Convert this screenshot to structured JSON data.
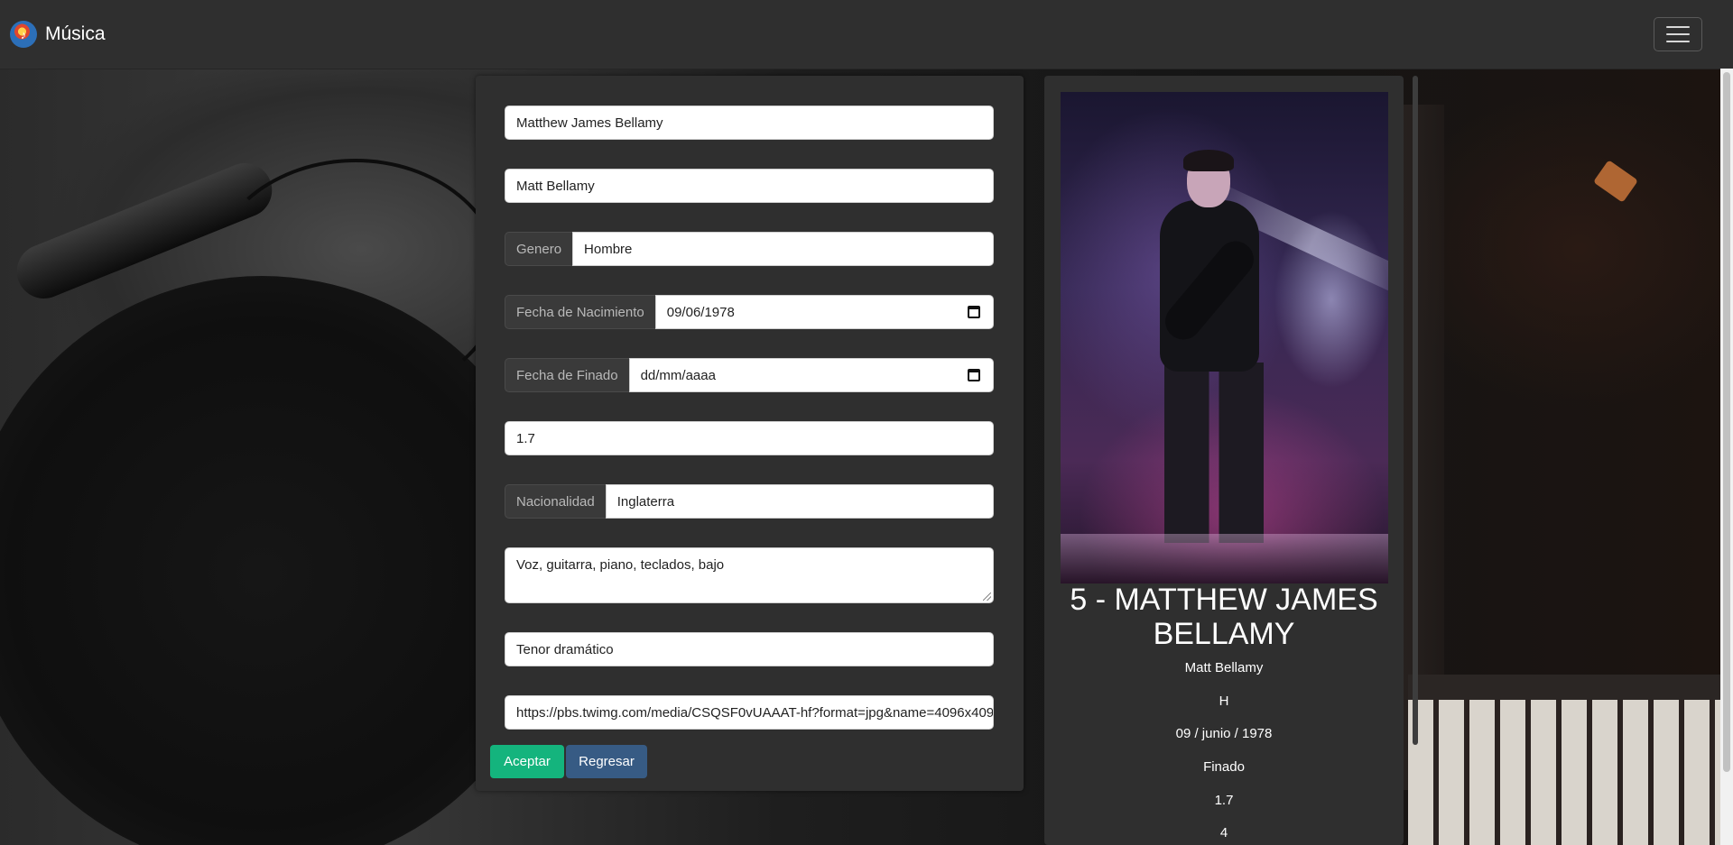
{
  "navbar": {
    "brand_logo_icon": "music-note-icon",
    "brand": "Música",
    "menu_icon": "hamburger-menu-icon"
  },
  "form": {
    "full_name": "Matthew James Bellamy",
    "stage_name": "Matt Bellamy",
    "genero_label": "Genero",
    "genero_value": "Hombre",
    "birth_label": "Fecha de Nacimiento",
    "birth_value": "09/06/1978",
    "death_label": "Fecha de Finado",
    "death_value": "dd/mm/aaaa",
    "height": "1.7",
    "nationality_label": "Nacionalidad",
    "nationality_value": "Inglaterra",
    "instruments": "Voz, guitarra, piano, teclados, bajo",
    "voice": "Tenor dramático",
    "image_url": "https://pbs.twimg.com/media/CSQSF0vUAAAT-hf?format=jpg&name=4096x4096",
    "accept_label": "Aceptar",
    "back_label": "Regresar"
  },
  "profile": {
    "title": "5 - MATTHEW JAMES BELLAMY",
    "stage_name": "Matt Bellamy",
    "gender": "H",
    "birth": "09 / junio / 1978",
    "status": "Finado",
    "height": "1.7",
    "count": "4"
  },
  "colors": {
    "accept": "#14b47d",
    "back": "#375b84",
    "panel": "#2f2f2f"
  }
}
